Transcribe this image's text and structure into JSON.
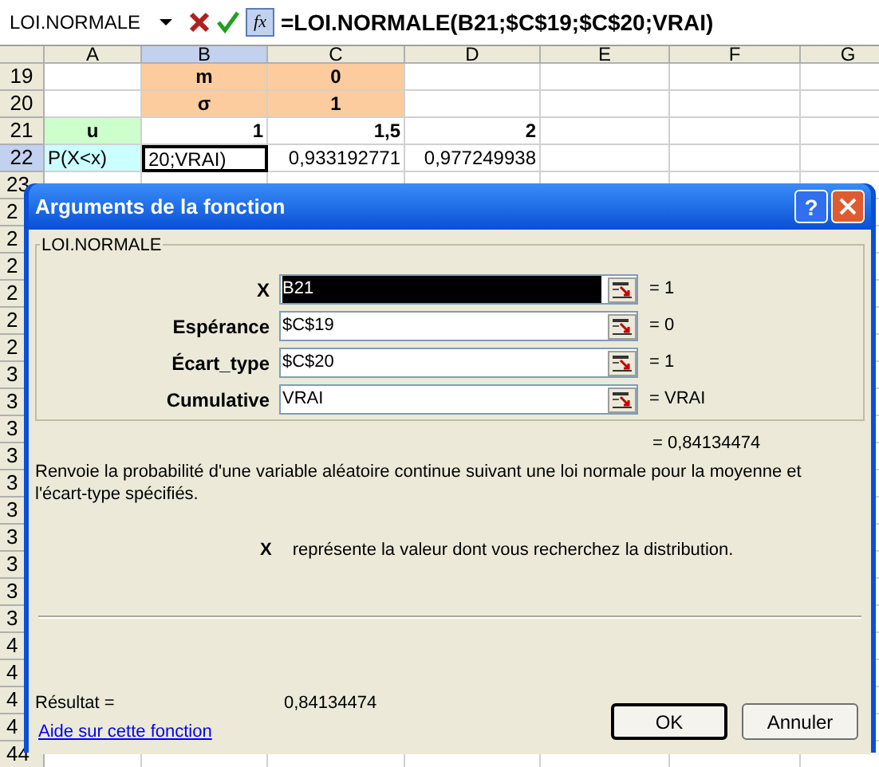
{
  "formula_bar": {
    "name_box": "LOI.NORMALE",
    "function_button": "fx",
    "formula": "=LOI.NORMALE(B21;$C$19;$C$20;VRAI)"
  },
  "sheet": {
    "columns": [
      {
        "label": "A",
        "selected": false
      },
      {
        "label": "B",
        "selected": true
      },
      {
        "label": "C",
        "selected": false
      },
      {
        "label": "D",
        "selected": false
      },
      {
        "label": "E",
        "selected": false
      },
      {
        "label": "F",
        "selected": false
      },
      {
        "label": "G",
        "selected": false
      }
    ],
    "rows": [
      {
        "header": "19",
        "selected": false,
        "cells": [
          {},
          {
            "kind": "label",
            "text": "m",
            "color": "#fccc9e"
          },
          {
            "kind": "label",
            "text": "0",
            "color": "#fccc9e"
          },
          {},
          {},
          {},
          {}
        ]
      },
      {
        "header": "20",
        "selected": false,
        "cells": [
          {},
          {
            "kind": "label",
            "text": "σ",
            "color": "#fccc9e"
          },
          {
            "kind": "label",
            "text": "1",
            "color": "#fccc9e"
          },
          {},
          {},
          {},
          {}
        ]
      },
      {
        "header": "21",
        "selected": false,
        "cells": [
          {
            "kind": "label",
            "text": "u",
            "color": "#ccffcc"
          },
          {
            "kind": "number",
            "text": "1"
          },
          {
            "kind": "number",
            "text": "1,5"
          },
          {
            "kind": "number",
            "text": "2"
          },
          {},
          {},
          {}
        ]
      },
      {
        "header": "22",
        "selected": true,
        "cells": [
          {
            "kind": "text",
            "text": "P(X<x)",
            "color": "#ccffff"
          },
          {
            "kind": "text",
            "text": "20;VRAI)",
            "active": true
          },
          {
            "kind": "value",
            "text": "0,933192771"
          },
          {
            "kind": "value",
            "text": "0,977249938"
          },
          {},
          {},
          {}
        ]
      }
    ],
    "rows_behind": [
      "23",
      "2",
      "2",
      "2",
      "2",
      "2",
      "2",
      "3",
      "3",
      "3",
      "3",
      "3",
      "3",
      "3",
      "3",
      "3",
      "3",
      "4",
      "4",
      "4",
      "4",
      "44"
    ]
  },
  "dialog": {
    "title": "Arguments de la fonction",
    "help_button": "?",
    "group": "LOI.NORMALE",
    "arguments": [
      {
        "label": "X",
        "value": "B21",
        "selected": true,
        "result": "= 1"
      },
      {
        "label": "Espérance",
        "value": "$C$19",
        "selected": false,
        "result": "= 0"
      },
      {
        "label": "Écart_type",
        "value": "$C$20",
        "selected": false,
        "result": "= 1"
      },
      {
        "label": "Cumulative",
        "value": "VRAI",
        "selected": false,
        "result": "= VRAI"
      }
    ],
    "formula_result": "= 0,84134474",
    "description": "Renvoie la probabilité d'une variable aléatoire continue suivant une loi normale pour la moyenne et l'écart-type spécifiés.",
    "argument_help": {
      "name": "X",
      "text": "représente la valeur dont vous recherchez la distribution."
    },
    "result_label": "Résultat =",
    "result_value": "0,84134474",
    "help_link": "Aide sur cette fonction",
    "buttons": [
      {
        "label": "OK",
        "default": true
      },
      {
        "label": "Annuler",
        "default": false
      }
    ]
  }
}
